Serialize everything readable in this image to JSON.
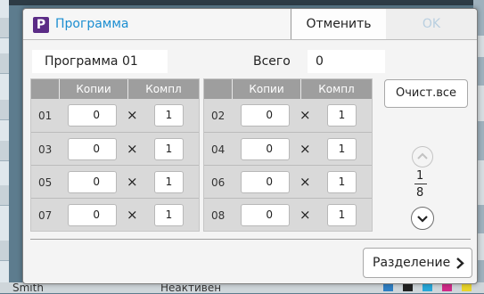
{
  "background": {
    "status_user": "Smith",
    "status_text": "Неактивен"
  },
  "dialog": {
    "badge": "P",
    "title": "Программа",
    "cancel_label": "Отменить",
    "ok_label": "OK",
    "program_name": "Программа 01",
    "total_label": "Всего",
    "total_value": "0",
    "headers": {
      "copies": "Копии",
      "sets": "Компл"
    },
    "times_symbol": "×",
    "rows": [
      {
        "num": "01",
        "copies": "0",
        "sets": "1"
      },
      {
        "num": "02",
        "copies": "0",
        "sets": "1"
      },
      {
        "num": "03",
        "copies": "0",
        "sets": "1"
      },
      {
        "num": "04",
        "copies": "0",
        "sets": "1"
      },
      {
        "num": "05",
        "copies": "0",
        "sets": "1"
      },
      {
        "num": "06",
        "copies": "0",
        "sets": "1"
      },
      {
        "num": "07",
        "copies": "0",
        "sets": "1"
      },
      {
        "num": "08",
        "copies": "0",
        "sets": "1"
      }
    ],
    "clear_all_label": "Очист.все",
    "page_current": "1",
    "page_total": "8",
    "split_label": "Разделение"
  },
  "icons": {
    "scroll_up": "chevron-up-icon",
    "scroll_down": "chevron-down-icon",
    "split_arrow": "chevron-right-icon"
  },
  "colors": {
    "title": "#1b8ed1",
    "badge": "#5b2c86",
    "ok_disabled": "#b9cfe0",
    "header_bg": "#9e9e9e"
  }
}
